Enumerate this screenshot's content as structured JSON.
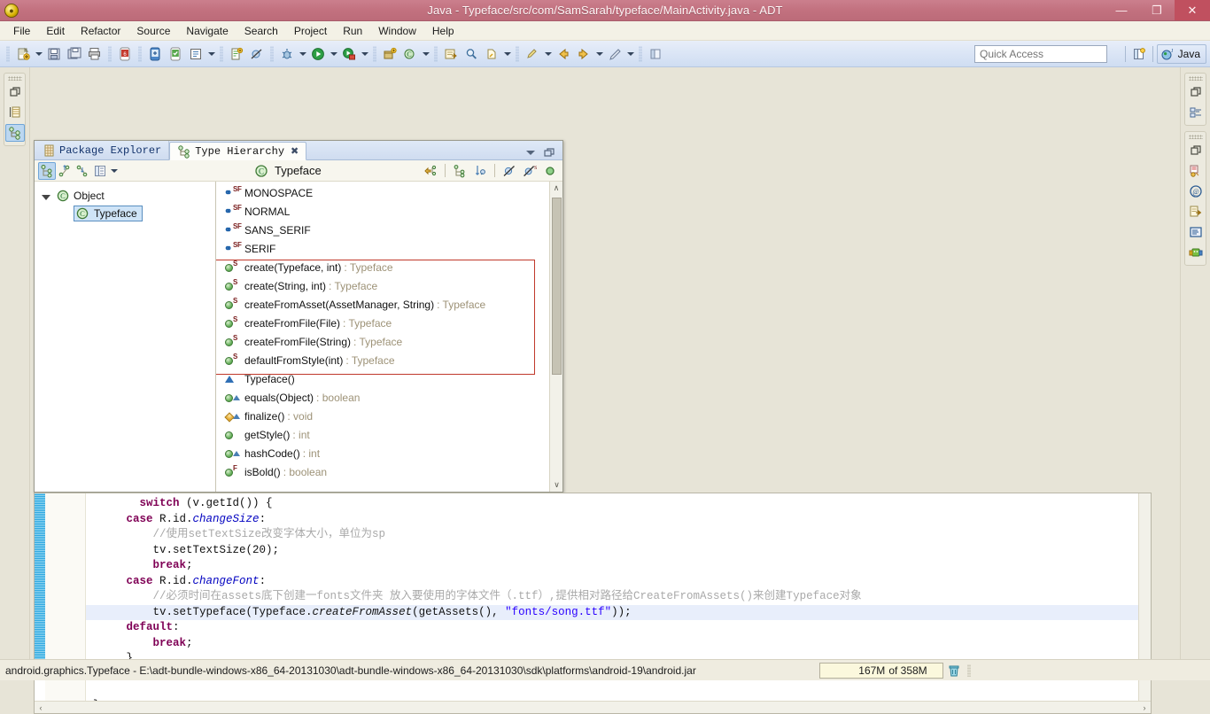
{
  "window": {
    "title": "Java - Typeface/src/com/SamSarah/typeface/MainActivity.java - ADT",
    "app_icon": "android-adt-icon",
    "minimize_label": "—",
    "maximize_label": "❐",
    "close_label": "✕"
  },
  "menubar": {
    "items": [
      {
        "label": "File"
      },
      {
        "label": "Edit"
      },
      {
        "label": "Refactor"
      },
      {
        "label": "Source"
      },
      {
        "label": "Navigate"
      },
      {
        "label": "Search"
      },
      {
        "label": "Project"
      },
      {
        "label": "Run"
      },
      {
        "label": "Window"
      },
      {
        "label": "Help"
      }
    ]
  },
  "toolbar": {
    "quick_access_placeholder": "Quick Access",
    "perspective_open_icon": "open-perspective-icon",
    "perspective_java_label": "Java",
    "perspective_java_icon": "java-perspective-icon",
    "buttons": [
      {
        "name": "new-wizard-icon"
      },
      {
        "name": "save-icon"
      },
      {
        "name": "save-all-icon"
      },
      {
        "name": "print-icon"
      },
      {
        "name": "android-sdk-manager-icon"
      },
      {
        "name": "android-virtual-device-manager-icon"
      },
      {
        "name": "lint-warnings-icon"
      },
      {
        "name": "new-android-project-icon"
      },
      {
        "name": "new-xml-file-icon"
      },
      {
        "name": "skip-all-breakpoints-icon"
      },
      {
        "name": "debug-icon"
      },
      {
        "name": "run-icon"
      },
      {
        "name": "run-external-tools-icon"
      },
      {
        "name": "new-java-package-icon"
      },
      {
        "name": "new-java-class-icon"
      },
      {
        "name": "open-type-icon"
      },
      {
        "name": "search-icon"
      },
      {
        "name": "next-annotation-icon"
      },
      {
        "name": "previous-annotation-icon"
      },
      {
        "name": "last-edit-location-icon"
      },
      {
        "name": "back-icon"
      },
      {
        "name": "forward-icon"
      },
      {
        "name": "pin-editor-icon"
      }
    ]
  },
  "left_fastview": {
    "groups": [
      {
        "buttons": [
          {
            "name": "restore-icon"
          },
          {
            "name": "package-explorer-icon"
          },
          {
            "name": "type-hierarchy-icon",
            "selected": true
          }
        ]
      }
    ]
  },
  "right_fastview": {
    "groups": [
      {
        "buttons": [
          {
            "name": "restore-icon"
          },
          {
            "name": "outline-icon"
          }
        ]
      },
      {
        "buttons": [
          {
            "name": "restore-icon"
          },
          {
            "name": "problems-icon"
          },
          {
            "name": "javadoc-icon"
          },
          {
            "name": "declaration-icon"
          },
          {
            "name": "console-icon"
          },
          {
            "name": "logcat-icon"
          }
        ]
      }
    ]
  },
  "type_hierarchy": {
    "tabs": [
      {
        "label": "Package Explorer",
        "icon": "package-explorer-icon",
        "active": false,
        "closable": false
      },
      {
        "label": "Type Hierarchy",
        "icon": "type-hierarchy-icon",
        "active": true,
        "closable": true,
        "close_glyph": "✖"
      }
    ],
    "view_menu_icon": "view-menu-icon",
    "minimize_icon": "minimize-view-icon",
    "title": "Typeface",
    "title_icon": "class-icon",
    "left_tools": [
      {
        "name": "show-type-hierarchy-icon",
        "selected": true
      },
      {
        "name": "show-supertype-hierarchy-icon",
        "selected": false
      },
      {
        "name": "show-subtype-hierarchy-icon",
        "selected": false
      },
      {
        "name": "layout-menu-icon",
        "selected": false
      }
    ],
    "right_tools": [
      {
        "name": "focus-on-selection-icon"
      },
      {
        "name": "lock-view-icon"
      },
      {
        "name": "sort-by-defining-type-icon"
      },
      {
        "name": "hide-fields-icon"
      },
      {
        "name": "hide-static-members-icon"
      },
      {
        "name": "hide-non-public-members-icon"
      }
    ],
    "tree": [
      {
        "label": "Object",
        "icon": "class-icon",
        "expanded": true,
        "depth": 0,
        "selected": false
      },
      {
        "label": "Typeface",
        "icon": "class-icon",
        "expanded": false,
        "depth": 1,
        "selected": true
      }
    ],
    "members": [
      {
        "name": "MONOSPACE",
        "type": "",
        "kind": "field",
        "modifiers": [
          "S",
          "F"
        ],
        "visibility": "public",
        "in_red_box": false
      },
      {
        "name": "NORMAL",
        "type": "",
        "kind": "field",
        "modifiers": [
          "S",
          "F"
        ],
        "visibility": "public",
        "in_red_box": false
      },
      {
        "name": "SANS_SERIF",
        "type": "",
        "kind": "field",
        "modifiers": [
          "S",
          "F"
        ],
        "visibility": "public",
        "in_red_box": false
      },
      {
        "name": "SERIF",
        "type": "",
        "kind": "field",
        "modifiers": [
          "S",
          "F"
        ],
        "visibility": "public",
        "in_red_box": false
      },
      {
        "name": "create(Typeface, int)",
        "type": " : Typeface",
        "kind": "method",
        "modifiers": [
          "S"
        ],
        "visibility": "public",
        "in_red_box": true
      },
      {
        "name": "create(String, int)",
        "type": " : Typeface",
        "kind": "method",
        "modifiers": [
          "S"
        ],
        "visibility": "public",
        "in_red_box": true
      },
      {
        "name": "createFromAsset(AssetManager, String)",
        "type": " : Typeface",
        "kind": "method",
        "modifiers": [
          "S"
        ],
        "visibility": "public",
        "in_red_box": true
      },
      {
        "name": "createFromFile(File)",
        "type": " : Typeface",
        "kind": "method",
        "modifiers": [
          "S"
        ],
        "visibility": "public",
        "in_red_box": true
      },
      {
        "name": "createFromFile(String)",
        "type": " : Typeface",
        "kind": "method",
        "modifiers": [
          "S"
        ],
        "visibility": "public",
        "in_red_box": true
      },
      {
        "name": "defaultFromStyle(int)",
        "type": " : Typeface",
        "kind": "method",
        "modifiers": [
          "S"
        ],
        "visibility": "public",
        "in_red_box": true
      },
      {
        "name": "Typeface()",
        "type": "",
        "kind": "constructor",
        "modifiers": [
          "C"
        ],
        "visibility": "package",
        "in_red_box": false
      },
      {
        "name": "equals(Object)",
        "type": " : boolean",
        "kind": "method",
        "modifiers": [
          "O"
        ],
        "visibility": "public",
        "in_red_box": false
      },
      {
        "name": "finalize()",
        "type": " : void",
        "kind": "method",
        "modifiers": [
          "O"
        ],
        "visibility": "protected",
        "in_red_box": false
      },
      {
        "name": "getStyle()",
        "type": " : int",
        "kind": "method",
        "modifiers": [],
        "visibility": "public",
        "in_red_box": false
      },
      {
        "name": "hashCode()",
        "type": " : int",
        "kind": "method",
        "modifiers": [
          "O"
        ],
        "visibility": "public",
        "in_red_box": false
      },
      {
        "name": "isBold()",
        "type": " : boolean",
        "kind": "method",
        "modifiers": [
          "F"
        ],
        "visibility": "public",
        "in_red_box": false
      }
    ],
    "scroll_up_glyph": "∧",
    "scroll_down_glyph": "∨"
  },
  "editor": {
    "scroll_left_glyph": "‹",
    "scroll_right_glyph": "›",
    "lines": [
      {
        "indent": 8,
        "highlight": false,
        "tokens": [
          {
            "t": "switch",
            "c": "kw"
          },
          {
            "t": " (v.getId()) {",
            "c": ""
          }
        ]
      },
      {
        "indent": 6,
        "highlight": false,
        "tokens": [
          {
            "t": "case",
            "c": "kw"
          },
          {
            "t": " R.id.",
            "c": ""
          },
          {
            "t": "changeSize",
            "c": "fld"
          },
          {
            "t": ":",
            "c": ""
          }
        ]
      },
      {
        "indent": 10,
        "highlight": false,
        "tokens": [
          {
            "t": "//使用setTextSize改变字体大小，单位为sp",
            "c": "cmt"
          }
        ]
      },
      {
        "indent": 10,
        "highlight": false,
        "tokens": [
          {
            "t": "tv.setTextSize(20);",
            "c": ""
          }
        ]
      },
      {
        "indent": 10,
        "highlight": false,
        "tokens": [
          {
            "t": "break",
            "c": "kw"
          },
          {
            "t": ";",
            "c": ""
          }
        ]
      },
      {
        "indent": 6,
        "highlight": false,
        "tokens": [
          {
            "t": "case",
            "c": "kw"
          },
          {
            "t": " R.id.",
            "c": ""
          },
          {
            "t": "changeFont",
            "c": "fld"
          },
          {
            "t": ":",
            "c": ""
          }
        ]
      },
      {
        "indent": 10,
        "highlight": false,
        "tokens": [
          {
            "t": "//必须时间在assets底下创建一fonts文件夹 放入要使用的字体文件（.ttf）,提供相对路径给CreateFromAssets()来创建Typeface对象",
            "c": "cmt"
          }
        ]
      },
      {
        "indent": 10,
        "highlight": true,
        "tokens": [
          {
            "t": "tv.setTypeface(Typeface.",
            "c": ""
          },
          {
            "t": "createFromAsset",
            "c": "ital"
          },
          {
            "t": "(getAssets(), ",
            "c": ""
          },
          {
            "t": "\"fonts/song.ttf\"",
            "c": "str"
          },
          {
            "t": "));",
            "c": ""
          }
        ]
      },
      {
        "indent": 6,
        "highlight": false,
        "tokens": [
          {
            "t": "default",
            "c": "kw"
          },
          {
            "t": ":",
            "c": ""
          }
        ]
      },
      {
        "indent": 10,
        "highlight": false,
        "tokens": [
          {
            "t": "break",
            "c": "kw"
          },
          {
            "t": ";",
            "c": ""
          }
        ]
      },
      {
        "indent": 6,
        "highlight": false,
        "tokens": [
          {
            "t": "}",
            "c": ""
          }
        ]
      },
      {
        "indent": 4,
        "highlight": false,
        "tokens": [
          {
            "t": "}",
            "c": ""
          }
        ]
      },
      {
        "indent": 0,
        "highlight": false,
        "tokens": [
          {
            "t": "",
            "c": ""
          }
        ]
      },
      {
        "indent": 1,
        "highlight": false,
        "tokens": [
          {
            "t": "}",
            "c": ""
          }
        ]
      }
    ]
  },
  "statusbar": {
    "text": "android.graphics.Typeface - E:\\adt-bundle-windows-x86_64-20131030\\adt-bundle-windows-x86_64-20131030\\sdk\\platforms\\android-19\\android.jar",
    "heap_used": "167M",
    "heap_of": "of 358M",
    "gc_icon": "trash-icon"
  },
  "colors": {
    "titlebar": "#c2717f",
    "close_button": "#c0505f",
    "toolbar": "#dce6f6",
    "workbench_bg": "#e7e4d7",
    "selection": "#cfe4f7",
    "red_box_border": "#c0392b",
    "keyword": "#7f0055",
    "string": "#2a00ff",
    "comment": "#a9a9a9",
    "return_type": "#9d9277",
    "change_marker": "#2fa8e0",
    "heap_bg": "#fbf8dd"
  }
}
